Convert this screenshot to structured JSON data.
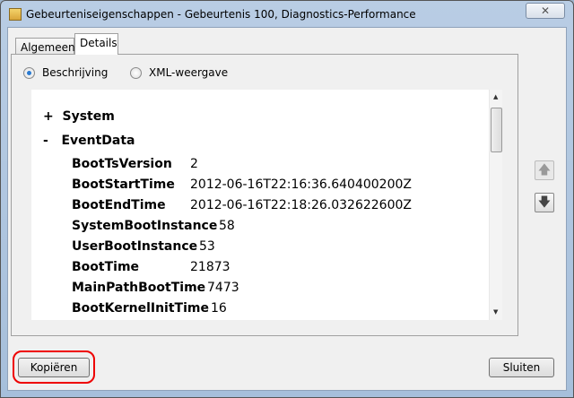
{
  "window": {
    "title": "Gebeurteniseigenschappen - Gebeurtenis 100, Diagnostics-Performance",
    "close": "✕"
  },
  "tabs": [
    {
      "label": "Algemeen"
    },
    {
      "label": "Details"
    }
  ],
  "view": {
    "option1": "Beschrijving",
    "option2": "XML-weergave",
    "selected": "Beschrijving"
  },
  "tree": {
    "system": {
      "toggle": "+",
      "label": "System"
    },
    "eventdata": {
      "toggle": "-",
      "label": "EventData"
    },
    "rows": [
      {
        "key": "BootTsVersion",
        "value": "2"
      },
      {
        "key": "BootStartTime",
        "value": "2012-06-16T22:16:36.640400200Z"
      },
      {
        "key": "BootEndTime",
        "value": "2012-06-16T22:18:26.032622600Z"
      },
      {
        "key": "SystemBootInstance",
        "value": "58"
      },
      {
        "key": "UserBootInstance",
        "value": "53"
      },
      {
        "key": "BootTime",
        "value": "21873"
      },
      {
        "key": "MainPathBootTime",
        "value": "7473"
      },
      {
        "key": "BootKernelInitTime",
        "value": "16"
      }
    ]
  },
  "buttons": {
    "copy": "Kopiëren",
    "close": "Sluiten",
    "up": "🡅",
    "down": "🡇"
  }
}
